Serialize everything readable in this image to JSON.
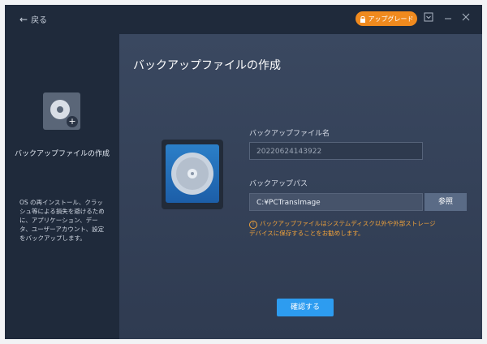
{
  "titlebar": {
    "back_label": "戻る",
    "upgrade_label": "アップグレード",
    "icons": [
      "download-icon",
      "minimize-icon",
      "close-icon"
    ]
  },
  "sidebar": {
    "title": "バックアップファイルの作成",
    "description": "OS の再インストール、クラッシュ等による損失を避けるために、アプリケーション、データ、ユーザーアカウント、設定をバックアップします。"
  },
  "main": {
    "title": "バックアップファイルの作成",
    "filename_label": "バックアップファイル名",
    "filename_placeholder": "20220624143922",
    "path_label": "バックアップパス",
    "path_value": "C:¥PCTransImage",
    "browse_label": "参照",
    "warning": "バックアップファイルはシステムディスク以外や外部ストレージデバイスに保存することをお勧めします。",
    "confirm_label": "確認する"
  },
  "colors": {
    "accent": "#2d9cf0",
    "upgrade": "#f08a1e",
    "warning": "#f0a23a"
  }
}
